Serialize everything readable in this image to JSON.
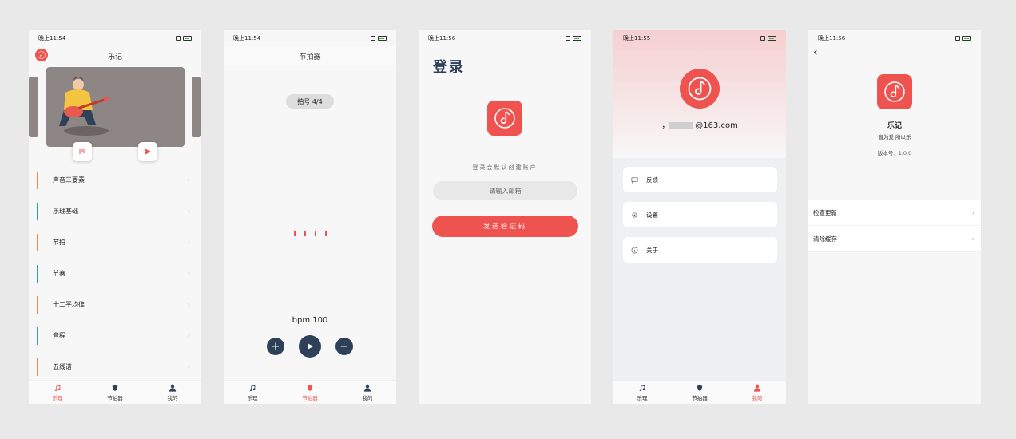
{
  "screen_home": {
    "time": "晚上11:54",
    "title": "乐记",
    "lessons": [
      {
        "label": "声音三要素",
        "color": "#f08a4b"
      },
      {
        "label": "乐理基础",
        "color": "#26a69a"
      },
      {
        "label": "节拍",
        "color": "#f08a4b"
      },
      {
        "label": "节奏",
        "color": "#26a69a"
      },
      {
        "label": "十二平均律",
        "color": "#f08a4b"
      },
      {
        "label": "音程",
        "color": "#26a69a"
      },
      {
        "label": "五线谱",
        "color": "#f08a4b"
      }
    ],
    "chevron": "›"
  },
  "screen_metronome": {
    "time": "晚上11:54",
    "title": "节拍器",
    "meter": "拍号  4/4",
    "bpm": "bpm 100",
    "plus": "+",
    "minus": "−"
  },
  "screen_login": {
    "time": "晚上11:56",
    "title": "登录",
    "hint": "登录会默认创建账户",
    "email_placeholder": "请输入邮箱",
    "send_button": "发送验证码"
  },
  "screen_profile": {
    "time": "晚上11:55",
    "email": "@163.com",
    "email_prefix": "，",
    "menu": {
      "feedback": "反馈",
      "settings": "设置",
      "about": "关于"
    }
  },
  "screen_about": {
    "time": "晚上11:56",
    "app_name": "乐记",
    "slogan": "音为爱 所以乐",
    "version": "版本号：1.0.0",
    "rows": {
      "check_update": "检查更新",
      "clear_cache": "清除缓存"
    },
    "chevron": "›"
  },
  "tabs": {
    "theory": "乐理",
    "metronome": "节拍器",
    "mine": "我的"
  },
  "colors": {
    "accent": "#ef5350",
    "dark": "#2e4159"
  }
}
